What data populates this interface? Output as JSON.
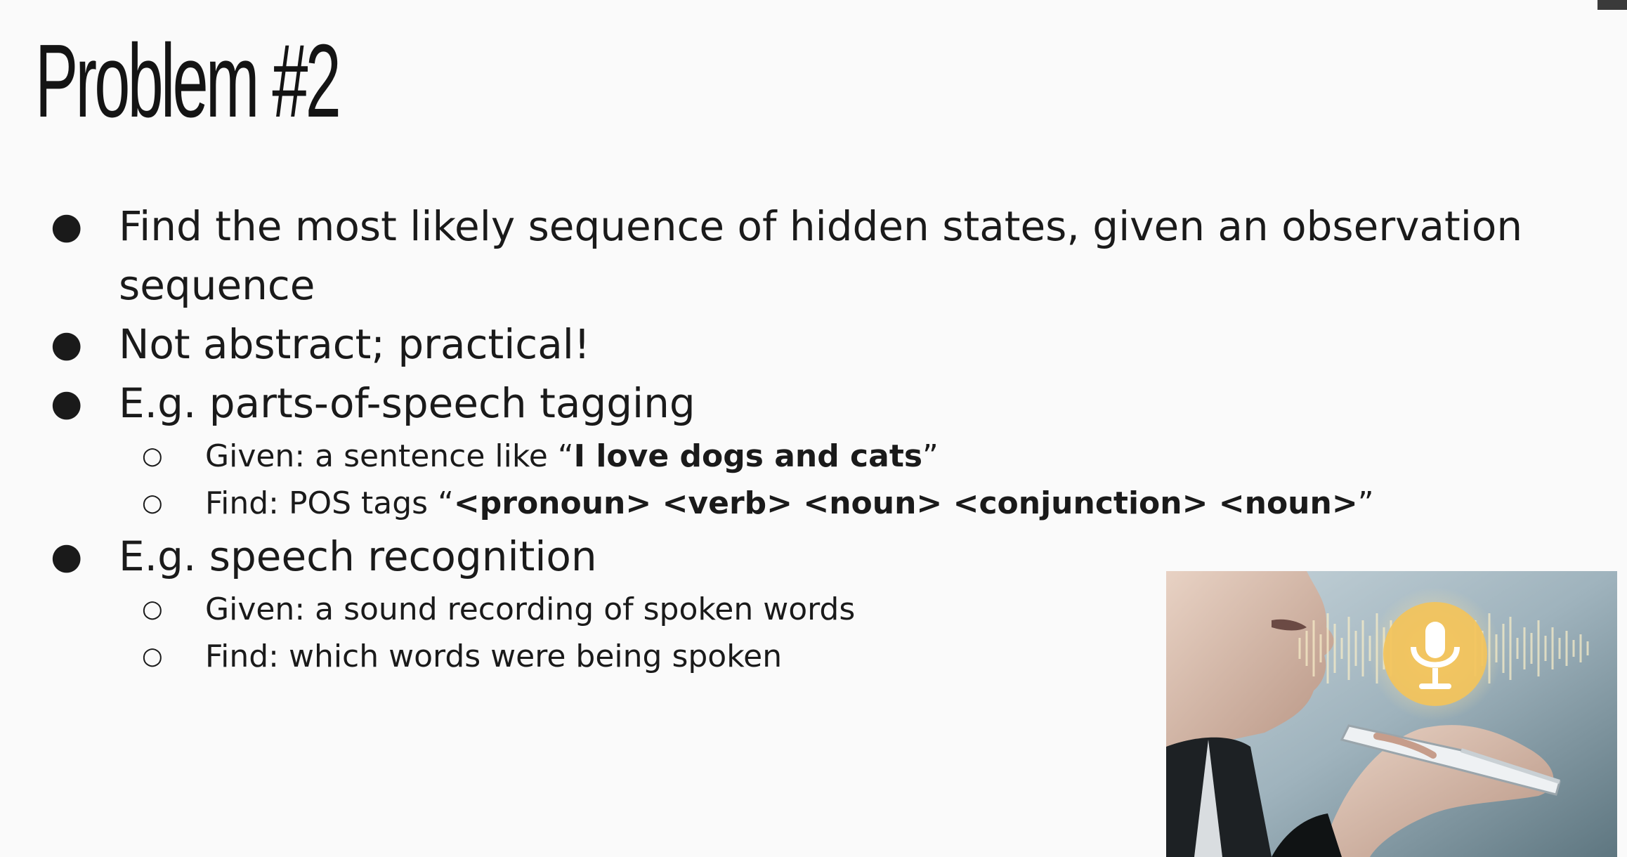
{
  "slide": {
    "title": "Problem #2",
    "bullets": [
      {
        "text": "Find the most likely sequence of hidden states, given an observation sequence"
      },
      {
        "text": "Not abstract; practical!"
      },
      {
        "text": "E.g. parts-of-speech tagging",
        "subs": [
          {
            "prefix": "Given: a sentence like “",
            "bold": "I love dogs and cats",
            "suffix": "”"
          },
          {
            "prefix": "Find: POS tags “",
            "bold": "<pronoun> <verb> <noun> <conjunction> <noun>",
            "suffix": "”"
          }
        ]
      },
      {
        "text": "E.g. speech recognition",
        "subs": [
          {
            "text": "Given: a sound recording of spoken words"
          },
          {
            "text": "Find: which words were being spoken"
          }
        ]
      }
    ],
    "bullet_glyph": "●",
    "sub_bullet_glyph": "○"
  },
  "image": {
    "subject": "person speaking into smartphone with microphone icon and sound waves",
    "icon": "microphone-icon",
    "accent_color": "#f3c35a"
  }
}
